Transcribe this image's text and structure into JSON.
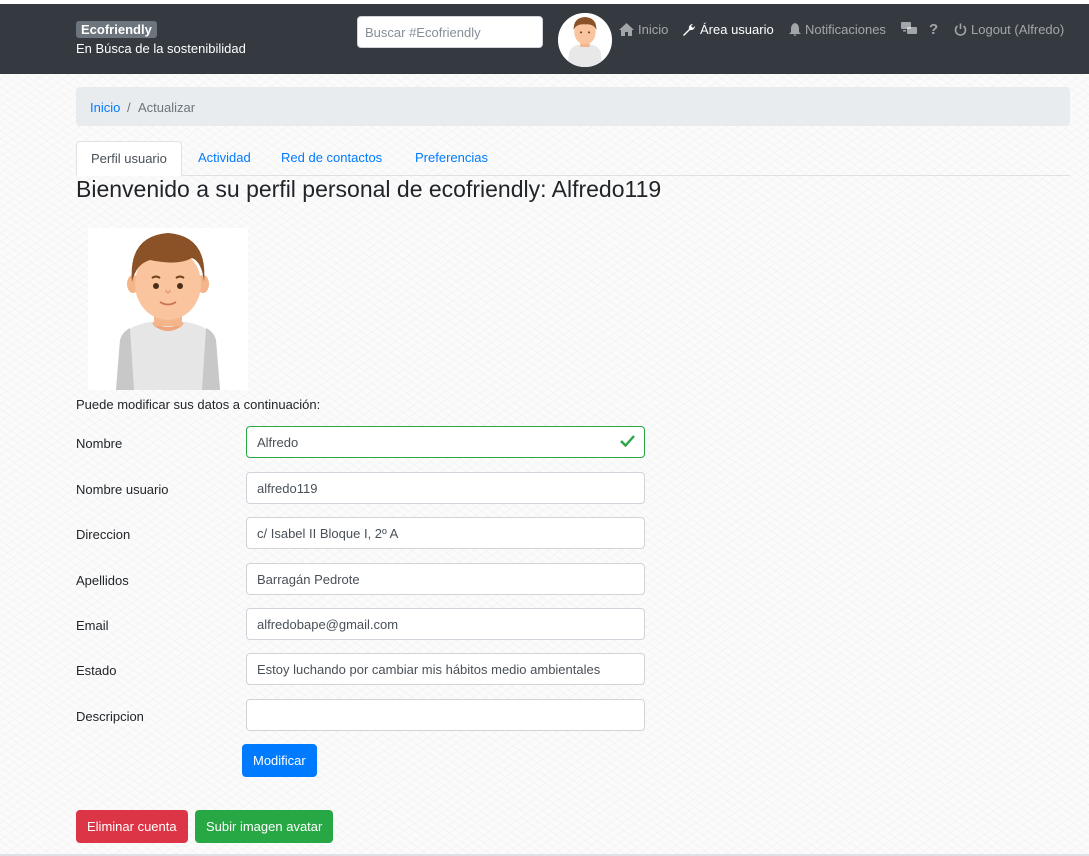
{
  "navbar": {
    "brand": "Ecofriendly",
    "tagline": "En Búsca de la sostenibilidad",
    "search_placeholder": "Buscar #Ecofriendly",
    "links": {
      "inicio": "Inicio",
      "area_usuario": "Área usuario",
      "notificaciones": "Notificaciones",
      "help": "?",
      "logout": "Logout (Alfredo)"
    },
    "icons": [
      "home-icon",
      "wrench-icon",
      "bell-icon",
      "chat-icon",
      "help-icon",
      "power-icon"
    ]
  },
  "breadcrumb": {
    "home": "Inicio",
    "separator": "/",
    "current": "Actualizar"
  },
  "tabs": [
    "Perfil usuario",
    "Actividad",
    "Red de contactos",
    "Preferencias"
  ],
  "page_title": "Bienvenido a su perfil personal de ecofriendly: Alfredo119",
  "form": {
    "intro": "Puede modificar sus datos a continuación:",
    "fields": {
      "nombre": {
        "label": "Nombre",
        "value": "Alfredo"
      },
      "nombre_usuario": {
        "label": "Nombre usuario",
        "value": "alfredo119"
      },
      "direccion": {
        "label": "Direccion",
        "value": "c/ Isabel II Bloque I, 2º A"
      },
      "apellidos": {
        "label": "Apellidos",
        "value": "Barragán Pedrote"
      },
      "email": {
        "label": "Email",
        "value": "alfredobape@gmail.com"
      },
      "estado": {
        "label": "Estado",
        "value": "Estoy luchando por cambiar mis hábitos medio ambientales"
      },
      "descripcion": {
        "label": "Descripcion",
        "value": ""
      }
    },
    "submit_label": "Modificar"
  },
  "actions": {
    "delete_label": "Eliminar cuenta",
    "upload_label": "Subir imagen avatar"
  },
  "colors": {
    "navbar_bg": "#343a40",
    "primary": "#007bff",
    "danger": "#dc3545",
    "success": "#28a745",
    "breadcrumb_bg": "#e9ecef"
  }
}
